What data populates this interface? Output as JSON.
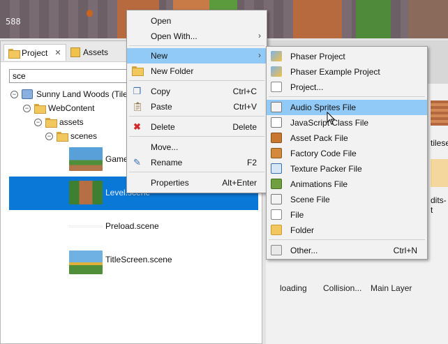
{
  "game_preview": {
    "coordinate_readout": "588"
  },
  "tabs": [
    {
      "label": "Project"
    },
    {
      "label": "Assets"
    }
  ],
  "filter": {
    "value": "sce"
  },
  "tree": {
    "project": "Sunny Land Woods (Tile",
    "webcontent": "WebContent",
    "assets": "assets",
    "scenes": "scenes"
  },
  "scenes": [
    {
      "label": "Game"
    },
    {
      "label": "Level.scene"
    },
    {
      "label": "Preload.scene"
    },
    {
      "label": "TitleScreen.scene"
    }
  ],
  "right_panel": {
    "partial_labels": [
      "tileset",
      "dits-t"
    ],
    "bottom_labels": [
      "loading",
      "Collision...",
      "Main Layer"
    ]
  },
  "context_menu": {
    "items": [
      {
        "label": "Open",
        "shortcut": "",
        "submenu": false,
        "icon": ""
      },
      {
        "label": "Open With...",
        "shortcut": "",
        "submenu": true,
        "icon": ""
      },
      {
        "label": "New",
        "shortcut": "",
        "submenu": true,
        "icon": ""
      },
      {
        "label": "New Folder",
        "shortcut": "",
        "submenu": false,
        "icon": "new-folder-icon"
      },
      {
        "label": "Copy",
        "shortcut": "Ctrl+C",
        "submenu": false,
        "icon": "copy-icon"
      },
      {
        "label": "Paste",
        "shortcut": "Ctrl+V",
        "submenu": false,
        "icon": "paste-icon"
      },
      {
        "label": "Delete",
        "shortcut": "Delete",
        "submenu": false,
        "icon": "delete-icon"
      },
      {
        "label": "Move...",
        "shortcut": "",
        "submenu": false,
        "icon": ""
      },
      {
        "label": "Rename",
        "shortcut": "F2",
        "submenu": false,
        "icon": "rename-icon"
      },
      {
        "label": "Properties",
        "shortcut": "Alt+Enter",
        "submenu": false,
        "icon": ""
      }
    ],
    "highlighted": "New"
  },
  "new_submenu": {
    "items": [
      {
        "label": "Phaser Project",
        "shortcut": "",
        "icon": "phaser-project-icon"
      },
      {
        "label": "Phaser Example Project",
        "shortcut": "",
        "icon": "phaser-example-icon"
      },
      {
        "label": "Project...",
        "shortcut": "",
        "icon": "new-project-icon"
      },
      {
        "label": "Audio Sprites File",
        "shortcut": "",
        "icon": "audio-sprites-icon"
      },
      {
        "label": "JavaScript Class File",
        "shortcut": "",
        "icon": "js-class-icon"
      },
      {
        "label": "Asset Pack File",
        "shortcut": "",
        "icon": "asset-pack-icon"
      },
      {
        "label": "Factory Code File",
        "shortcut": "",
        "icon": "factory-code-icon"
      },
      {
        "label": "Texture Packer File",
        "shortcut": "",
        "icon": "texture-packer-icon"
      },
      {
        "label": "Animations File",
        "shortcut": "",
        "icon": "animations-icon"
      },
      {
        "label": "Scene File",
        "shortcut": "",
        "icon": "scene-file-icon"
      },
      {
        "label": "File",
        "shortcut": "",
        "icon": "file-icon"
      },
      {
        "label": "Folder",
        "shortcut": "",
        "icon": "folder-icon"
      },
      {
        "label": "Other...",
        "shortcut": "Ctrl+N",
        "icon": "other-icon"
      }
    ],
    "highlighted": "Audio Sprites File"
  },
  "colors": {
    "selection_blue": "#0a78d7",
    "menu_highlight": "#91c9f7",
    "game_bg": "#6d5f66"
  }
}
